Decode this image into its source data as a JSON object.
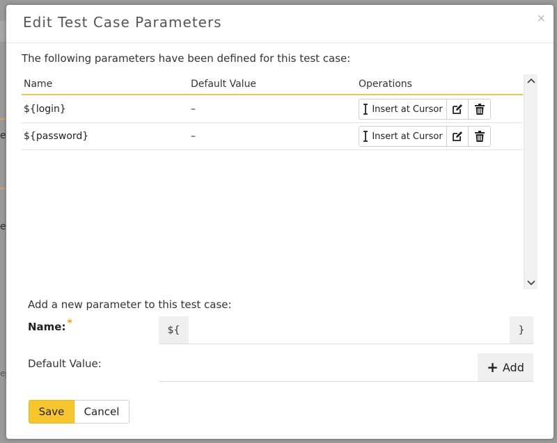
{
  "background": {
    "edge_texts": [
      "el",
      "e",
      "ep"
    ]
  },
  "dialog": {
    "title": "Edit Test Case Parameters",
    "close_glyph": "×",
    "intro": "The following parameters have been defined for this test case:",
    "table": {
      "columns": [
        "Name",
        "Default Value",
        "Operations"
      ],
      "rows": [
        {
          "name": "${login}",
          "default_value": "–"
        },
        {
          "name": "${password}",
          "default_value": "–"
        }
      ],
      "insert_label": "Insert at Cursor"
    },
    "add_form": {
      "heading": "Add a new parameter to this test case:",
      "name_label": "Name:",
      "required_marker": "*",
      "name_prefix": "${",
      "name_suffix": "}",
      "name_value": "",
      "default_label": "Default Value:",
      "default_value": "",
      "add_label": "Add"
    },
    "footer": {
      "save_label": "Save",
      "cancel_label": "Cancel"
    }
  },
  "colors": {
    "accent": "#f7c52d",
    "header_rule": "#f3c44d",
    "required": "#f0a020"
  },
  "icons": {
    "close": "close-icon",
    "insert": "text-cursor-icon",
    "edit": "edit-icon",
    "delete": "trash-icon",
    "scroll_up": "chevron-up-icon",
    "scroll_down": "chevron-down-icon",
    "add": "plus-icon"
  }
}
